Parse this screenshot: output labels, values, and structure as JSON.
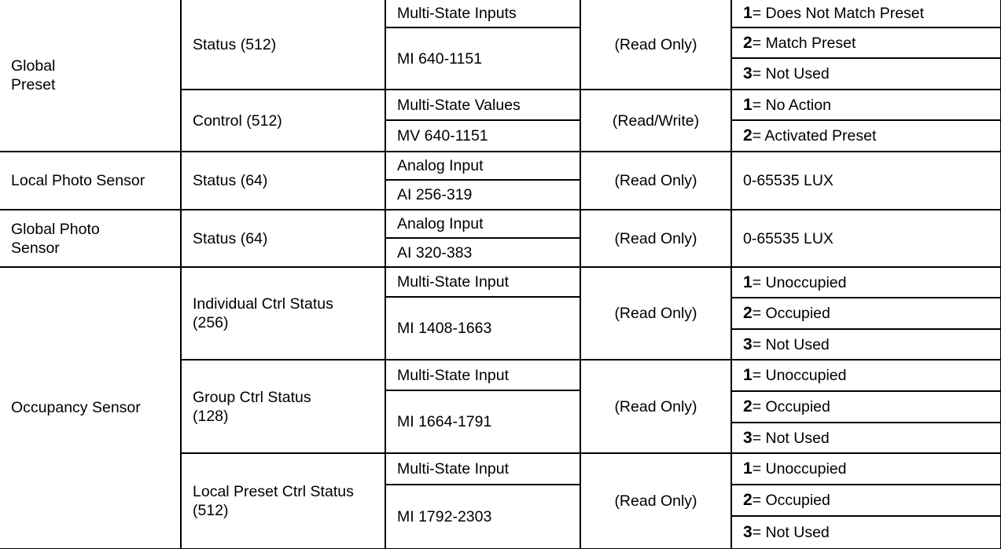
{
  "rows": [
    {
      "category": "Global Preset",
      "category_lines": [
        "Global",
        "Preset"
      ],
      "groups": [
        {
          "name": "Status (512)",
          "object_type": "Multi-State Inputs",
          "range": "MI 640-1151",
          "access": "(Read Only)",
          "values": [
            {
              "num": "1",
              "text": " = Does Not Match Preset"
            },
            {
              "num": "2",
              "text": " = Match Preset"
            },
            {
              "num": "3",
              "text": " = Not Used"
            }
          ]
        },
        {
          "name": "Control (512)",
          "object_type": "Multi-State Values",
          "range": "MV 640-1151",
          "access": "(Read/Write)",
          "values": [
            {
              "num": "1",
              "text": " = No Action"
            },
            {
              "num": "2",
              "text": " = Activated Preset"
            }
          ]
        }
      ]
    },
    {
      "category": "Local Photo Sensor",
      "groups": [
        {
          "name": "Status (64)",
          "object_type": "Analog Input",
          "range": "AI 256-319",
          "access": "(Read Only)",
          "value": "0-65535 LUX"
        }
      ]
    },
    {
      "category": "Global Photo Sensor",
      "category_lines": [
        "Global Photo",
        "Sensor"
      ],
      "groups": [
        {
          "name": "Status (64)",
          "object_type": "Analog Input",
          "range": "AI 320-383",
          "access": "(Read Only)",
          "value": "0-65535 LUX"
        }
      ]
    },
    {
      "category": "Occupancy Sensor",
      "groups": [
        {
          "name_lines": [
            "Individual Ctrl Status",
            "(256)"
          ],
          "object_type": "Multi-State Input",
          "range": "MI 1408-1663",
          "access": "(Read Only)",
          "values": [
            {
              "num": "1",
              "text": " = Unoccupied"
            },
            {
              "num": "2",
              "text": " = Occupied"
            },
            {
              "num": "3",
              "text": " = Not Used"
            }
          ]
        },
        {
          "name_lines": [
            "Group Ctrl Status",
            "(128)"
          ],
          "object_type": "Multi-State Input",
          "range": "MI 1664-1791",
          "access": "(Read Only)",
          "values": [
            {
              "num": "1",
              "text": " = Unoccupied"
            },
            {
              "num": "2",
              "text": " = Occupied"
            },
            {
              "num": "3",
              "text": " = Not Used"
            }
          ]
        },
        {
          "name_lines": [
            "Local Preset Ctrl Status",
            "(512)"
          ],
          "object_type": "Multi-State Input",
          "range": "MI 1792-2303",
          "access": "(Read Only)",
          "values": [
            {
              "num": "1",
              "text": " = Unoccupied"
            },
            {
              "num": "2",
              "text": " = Occupied"
            },
            {
              "num": "3",
              "text": " = Not Used"
            }
          ]
        }
      ]
    }
  ]
}
